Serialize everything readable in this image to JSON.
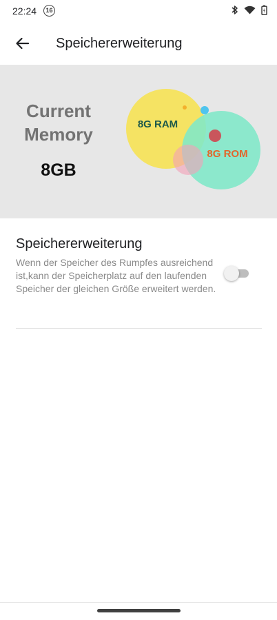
{
  "status_bar": {
    "time": "22:24",
    "notification_count": "16",
    "icons": [
      "bluetooth-icon",
      "wifi-icon",
      "battery-icon"
    ]
  },
  "app_bar": {
    "back_icon": "arrow-left-icon",
    "title": "Speichererweiterung"
  },
  "hero": {
    "label_line1": "Current",
    "label_line2": "Memory",
    "value": "8GB",
    "ram_label": "8G RAM",
    "rom_label": "8G ROM",
    "colors": {
      "background": "#e7e7e7",
      "ram_bubble": "#f6e35c",
      "rom_bubble": "#7fe8c8",
      "ram_text": "#1f5a4a",
      "rom_text": "#e2662b"
    }
  },
  "setting": {
    "title": "Speichererweiterung",
    "description": "Wenn der Speicher des Rumpfes ausreichend ist,kann der Speicherplatz auf den laufenden Speicher der gleichen Größe erweitert werden.",
    "toggle_on": false
  }
}
